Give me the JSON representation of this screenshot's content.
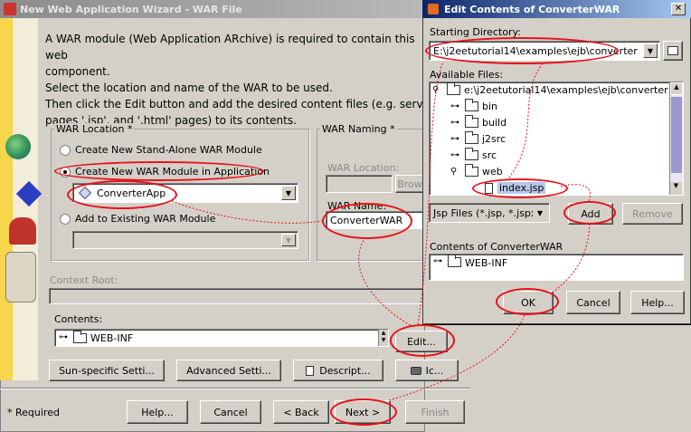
{
  "wizard": {
    "title": "New Web Application Wizard - WAR File",
    "intro": [
      "A WAR module (Web Application ARchive) is required to contain this web",
      "component.",
      "Select the location and name of the WAR to be used.",
      "Then click the Edit button and add the desired content files (e.g. servlets '.cla",
      "pages '.jsp', and '.html' pages) to its contents."
    ],
    "war_location": {
      "label": "WAR Location *",
      "option1": "Create New Stand-Alone WAR Module",
      "option2": "Create New WAR Module in Application",
      "app_select": "ConverterApp",
      "option3": "Add to Existing WAR Module"
    },
    "war_naming": {
      "label": "WAR Naming *",
      "location_label": "WAR Location:",
      "browse": "Brow",
      "name_label": "WAR Name:",
      "name_value": "ConverterWAR"
    },
    "context_root_label": "Context Root:",
    "contents_label": "Contents:",
    "contents_item": "WEB-INF",
    "edit_button": "Edit...",
    "sun_button": "Sun-specific Setti...",
    "advanced_button": "Advanced Setti...",
    "descript_button": "Descript...",
    "icons_button": "Ic...",
    "required": "* Required",
    "help": "Help...",
    "cancel": "Cancel",
    "back": "< Back",
    "next": "Next >",
    "finish": "Finish"
  },
  "edit": {
    "title": "Edit Contents of ConverterWAR",
    "starting_dir_label": "Starting Directory:",
    "starting_dir": "E:\\j2eetutorial14\\examples\\ejb\\converter",
    "available_label": "Available Files:",
    "tree": {
      "root": "e:\\j2eetutorial14\\examples\\ejb\\converter",
      "children": [
        "bin",
        "build",
        "j2src",
        "src",
        "web"
      ],
      "file": "index.jsp"
    },
    "filter": "Jsp Files (*.jsp, *.jspx)",
    "add": "Add",
    "remove": "Remove",
    "contents_label": "Contents of ConverterWAR",
    "contents_item": "WEB-INF",
    "ok": "OK",
    "cancel": "Cancel",
    "help": "Help..."
  }
}
